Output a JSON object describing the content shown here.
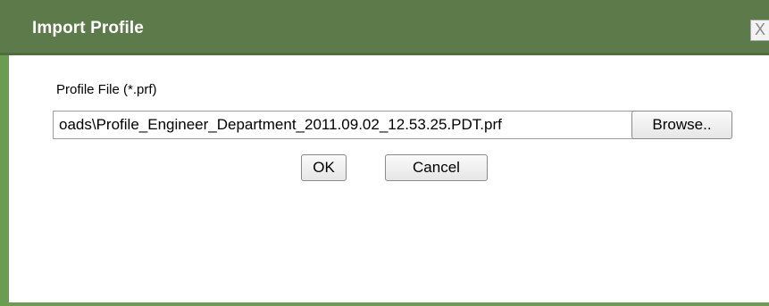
{
  "dialog": {
    "title": "Import Profile",
    "close_label": "X"
  },
  "form": {
    "file_label": "Profile File (*.prf)",
    "file_value": "oads\\Profile_Engineer_Department_2011.09.02_12.53.25.PDT.prf",
    "browse_label": "Browse..",
    "ok_label": "OK",
    "cancel_label": "Cancel"
  },
  "colors": {
    "titlebar": "#5c7a4a",
    "border": "#6b9c52"
  }
}
